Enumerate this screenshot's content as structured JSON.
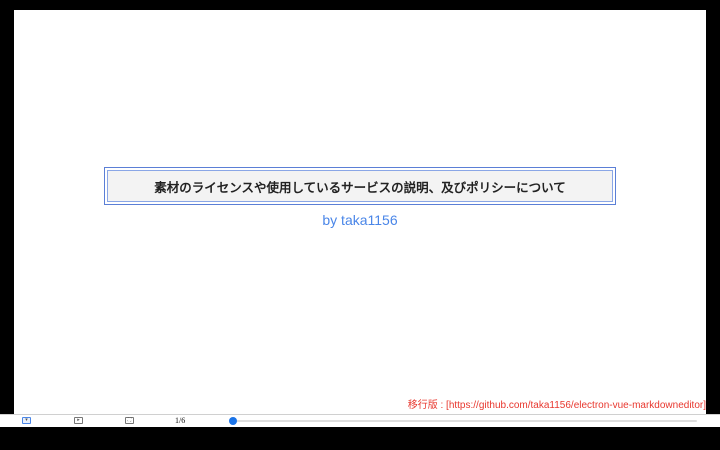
{
  "slide": {
    "title": "素材のライセンスや使用しているサービスの説明、及びポリシーについて",
    "byline": "by taka1156",
    "footer_note": "移行版 : [https://github.com/taka1156/electron-vue-markdowneditor]"
  },
  "controls": {
    "buttons": [
      {
        "name": "prev-slide",
        "icon": "chevron-down-icon",
        "glyph": "▾"
      },
      {
        "name": "next-slide",
        "icon": "chevron-right-icon",
        "glyph": "▸"
      },
      {
        "name": "fullscreen",
        "icon": "fullscreen-icon",
        "glyph": "⛶"
      }
    ],
    "page_indicator": "1/6",
    "progress_fraction": 0.0
  },
  "colors": {
    "accent": "#4a86e8",
    "footer": "#e8372e",
    "title_border": "#5b7fd6",
    "background": "#000000"
  }
}
